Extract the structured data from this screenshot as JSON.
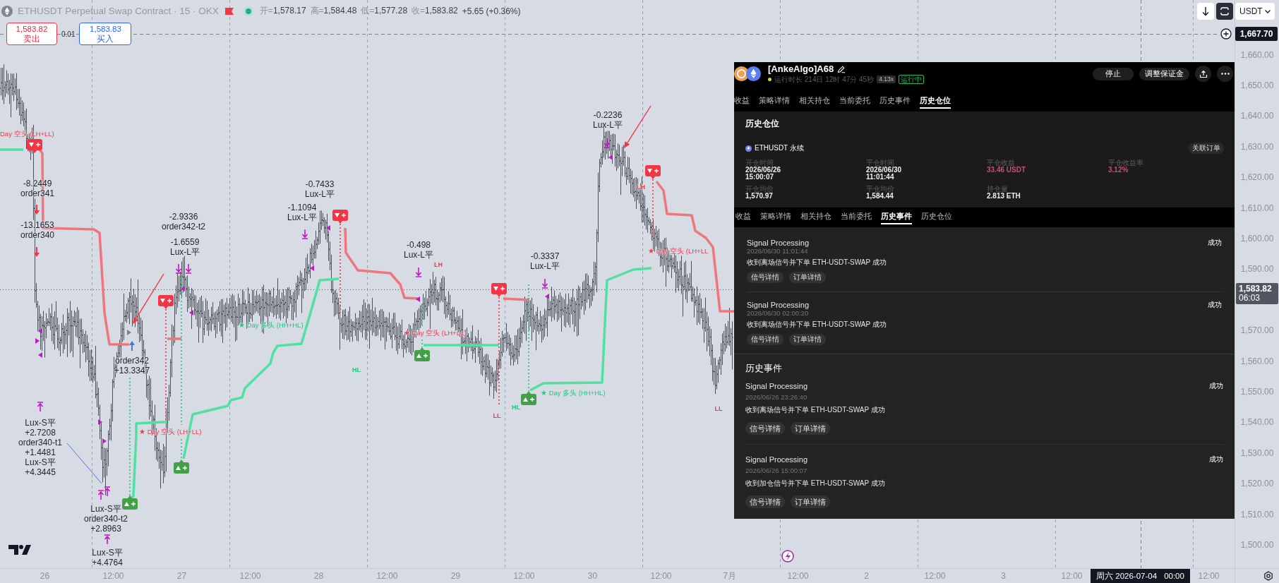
{
  "legend": {
    "symbol": "ETHUSDT Perpetual Swap Contract · 15 · OKX",
    "ohlc": [
      {
        "label": "开=",
        "value": "1,578.17"
      },
      {
        "label": "高=",
        "value": "1,584.48"
      },
      {
        "label": "低=",
        "value": "1,577.28"
      },
      {
        "label": "收=",
        "value": "1,583.82"
      }
    ],
    "change": "+5.65 (+0.36%)"
  },
  "trade_panel": {
    "orders": [
      {
        "kind": "sell",
        "price": "1,583.82",
        "label": "卖出"
      },
      {
        "kind": "buy",
        "price": "1,583.83",
        "label": "买入"
      }
    ],
    "quantity": "0.01"
  },
  "toolbar": {
    "currency": "USDT"
  },
  "chart": {
    "trade_labels": [
      {
        "lines": [
          "-8.2449",
          "order341"
        ]
      },
      {
        "lines": [
          "-13.1653",
          "order340"
        ]
      },
      {
        "lines": [
          "-2.9336",
          "order342-t2"
        ]
      },
      {
        "lines": [
          "-1.6559",
          "Lux-L平"
        ]
      },
      {
        "lines": [
          "-0.7433",
          "Lux-L平"
        ]
      },
      {
        "lines": [
          "-1.1094",
          "Lux-L平"
        ]
      },
      {
        "lines": [
          "-0.498",
          "Lux-L平"
        ]
      },
      {
        "lines": [
          "-0.3337",
          "Lux-L平"
        ]
      },
      {
        "lines": [
          "-0.2236",
          "Lux-L平"
        ]
      },
      {
        "lines": [
          "order342",
          "+13.3347"
        ]
      },
      {
        "lines": [
          "Lux-S平",
          "+2.7208",
          "order340-t1",
          "+1.4481",
          "Lux-S平",
          "+4.3445"
        ]
      },
      {
        "lines": [
          "Lux-S平",
          "order340-t2",
          "+2.8963"
        ]
      },
      {
        "lines": [
          "Lux-S平",
          "+4.4764"
        ]
      }
    ],
    "pivot_labels": [
      {
        "text": "LH",
        "kind": "bear"
      },
      {
        "text": "HL",
        "kind": "bull"
      },
      {
        "text": "LL",
        "kind": "bear"
      },
      {
        "text": "HL",
        "kind": "bull"
      },
      {
        "text": "LH",
        "kind": "bear"
      },
      {
        "text": "LL",
        "kind": "bear"
      }
    ],
    "trend_labels": [
      {
        "text": "Day 空头 (LH+LL)",
        "kind": "bear"
      },
      {
        "text": "★ Day 多头 (HH+HL)",
        "kind": "bull"
      },
      {
        "text": "★ Day 空头 (LH+LL)",
        "kind": "bear"
      },
      {
        "text": "★ Day 空头 (LH+LL)",
        "kind": "bear"
      },
      {
        "text": "★ Day 多头 (HH+HL)",
        "kind": "bull"
      },
      {
        "text": "★ Day 空头 (LH+LL",
        "kind": "bear"
      }
    ]
  },
  "price_axis": {
    "crosshair_price": "1,667.70",
    "items": [
      {
        "kind": "tick",
        "text": "1,660.00"
      },
      {
        "kind": "tick",
        "text": "1,650.00"
      },
      {
        "kind": "tick",
        "text": "1,640.00"
      },
      {
        "kind": "tick",
        "text": "1,630.00"
      },
      {
        "kind": "tick",
        "text": "1,620.00"
      },
      {
        "kind": "tick",
        "text": "1,610.00"
      },
      {
        "kind": "tick",
        "text": "1,600.00"
      },
      {
        "kind": "tick",
        "text": "1,590.00"
      },
      {
        "kind": "last_price",
        "price": "1,583.82",
        "countdown": "06:03"
      },
      {
        "kind": "tick",
        "text": "1,570.00"
      },
      {
        "kind": "tick",
        "text": "1,560.00"
      },
      {
        "kind": "tick",
        "text": "1,550.00"
      },
      {
        "kind": "tick",
        "text": "1,540.00"
      },
      {
        "kind": "tick",
        "text": "1,530.00"
      },
      {
        "kind": "tick",
        "text": "1,520.00"
      },
      {
        "kind": "tick",
        "text": "1,510.00"
      },
      {
        "kind": "tick",
        "text": "1,500.00"
      }
    ]
  },
  "time_axis": {
    "items": [
      {
        "kind": "tick",
        "text": "26"
      },
      {
        "kind": "tick",
        "text": "12:00"
      },
      {
        "kind": "tick",
        "text": "27"
      },
      {
        "kind": "tick",
        "text": "12:00"
      },
      {
        "kind": "tick",
        "text": "28"
      },
      {
        "kind": "tick",
        "text": "12:00"
      },
      {
        "kind": "tick",
        "text": "29"
      },
      {
        "kind": "tick",
        "text": "12:00"
      },
      {
        "kind": "tick",
        "text": "30"
      },
      {
        "kind": "tick",
        "text": "12:00"
      },
      {
        "kind": "tick",
        "text": "7月"
      },
      {
        "kind": "tick",
        "text": "12:00"
      },
      {
        "kind": "tick",
        "text": "2"
      },
      {
        "kind": "tick",
        "text": "12:00"
      },
      {
        "kind": "tick",
        "text": "3"
      },
      {
        "kind": "tick",
        "text": "12:00"
      },
      {
        "kind": "crosshair",
        "date": "周六 2026-07-04",
        "time": "00:00"
      },
      {
        "kind": "tick",
        "text": "12:00"
      }
    ]
  },
  "strategy_window": {
    "title": "[AnkeAlgo]A68",
    "runtime": "运行时长 214日 12时 47分 45秒",
    "leverage": "4.13x",
    "status": "运行中",
    "actions": [
      {
        "kind": "text",
        "label": "停止"
      },
      {
        "kind": "text",
        "label": "调整保证金"
      },
      {
        "kind": "share"
      },
      {
        "kind": "more"
      }
    ],
    "tabs": [
      {
        "label": "收益",
        "selected": false
      },
      {
        "label": "策略详情",
        "selected": false
      },
      {
        "label": "相关持仓",
        "selected": false
      },
      {
        "label": "当前委托",
        "selected": false
      },
      {
        "label": "历史事件",
        "selected": false
      },
      {
        "label": "历史仓位",
        "selected": true
      }
    ],
    "position": {
      "title": "历史仓位",
      "symbol": "ETHUSDT 永续",
      "link": "关联订单",
      "fields": [
        {
          "label": "开仓时间",
          "lines": [
            "2026/06/26",
            "15:00:07"
          ],
          "kind": "plain"
        },
        {
          "label": "平仓时间",
          "lines": [
            "2026/06/30",
            "11:01:44"
          ],
          "kind": "plain"
        },
        {
          "label": "平仓收益",
          "lines": [
            "33.46 USDT"
          ],
          "kind": "profit"
        },
        {
          "label": "平仓收益率",
          "lines": [
            "3.12%"
          ],
          "kind": "profit"
        },
        {
          "label": "开仓均价",
          "lines": [
            "1,570.97"
          ],
          "kind": "plain"
        },
        {
          "label": "平仓均价",
          "lines": [
            "1,584.44"
          ],
          "kind": "plain"
        },
        {
          "label": "持仓量",
          "lines": [
            "2.813 ETH"
          ],
          "kind": "plain"
        }
      ]
    },
    "event_tabs": [
      {
        "label": "收益",
        "selected": false
      },
      {
        "label": "策略详情",
        "selected": false
      },
      {
        "label": "相关持仓",
        "selected": false
      },
      {
        "label": "当前委托",
        "selected": false
      },
      {
        "label": "历史事件",
        "selected": true
      },
      {
        "label": "历史仓位",
        "selected": false
      }
    ],
    "events": [
      {
        "title": "Signal Processing",
        "time": "2026/06/30 11:01:44",
        "message": "收到离场信号并下单 ETH-USDT-SWAP 成功",
        "status": "成功",
        "actions": [
          "信号详情",
          "订单详情"
        ]
      },
      {
        "title": "Signal Processing",
        "time": "2026/06/30 02:00:20",
        "message": "收到离场信号并下单 ETH-USDT-SWAP 成功",
        "status": "成功",
        "actions": [
          "信号详情",
          "订单详情"
        ]
      }
    ],
    "history": {
      "title": "历史事件",
      "events": [
        {
          "title": "Signal Processing",
          "time": "2026/06/26 23:26:40",
          "message": "收到离场信号并下单 ETH-USDT-SWAP 成功",
          "status": "成功",
          "actions": [
            "信号详情",
            "订单详情"
          ]
        },
        {
          "title": "Signal Processing",
          "time": "2026/06/26 15:00:07",
          "message": "收到加仓信号并下单 ETH-USDT-SWAP 成功",
          "status": "成功",
          "actions": [
            "信号详情",
            "订单详情"
          ]
        }
      ]
    }
  }
}
